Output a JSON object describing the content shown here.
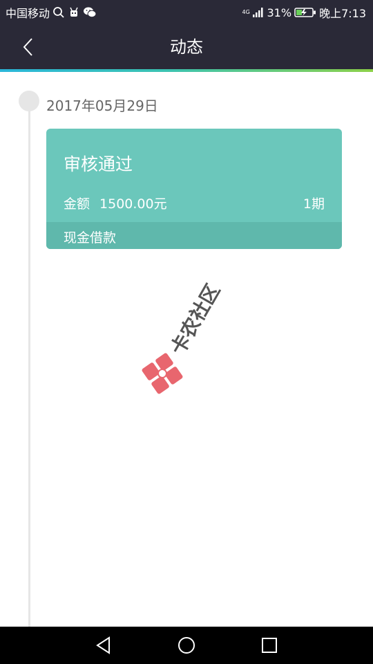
{
  "status_bar": {
    "carrier": "中国移动",
    "network_tag": "4G",
    "battery": "31%",
    "time": "晚上7:13"
  },
  "header": {
    "title": "动态",
    "back_icon": "chevron-left-icon"
  },
  "timeline": [
    {
      "date": "2017年05月29日",
      "card": {
        "status": "审核通过",
        "amount_label": "金额",
        "amount": "1500.00元",
        "period": "1期",
        "type": "现金借款"
      }
    }
  ],
  "watermark": {
    "text": "卡农社区"
  },
  "colors": {
    "bar_bg": "#2a2937",
    "card_bg": "#6bc7bb",
    "card_footer_bg": "#5fb8ac",
    "timeline_gray": "#e6e6e6",
    "watermark_red": "#e8666e"
  },
  "nav_bar": {
    "icons": [
      "back-triangle-icon",
      "home-circle-icon",
      "recents-square-icon"
    ]
  }
}
